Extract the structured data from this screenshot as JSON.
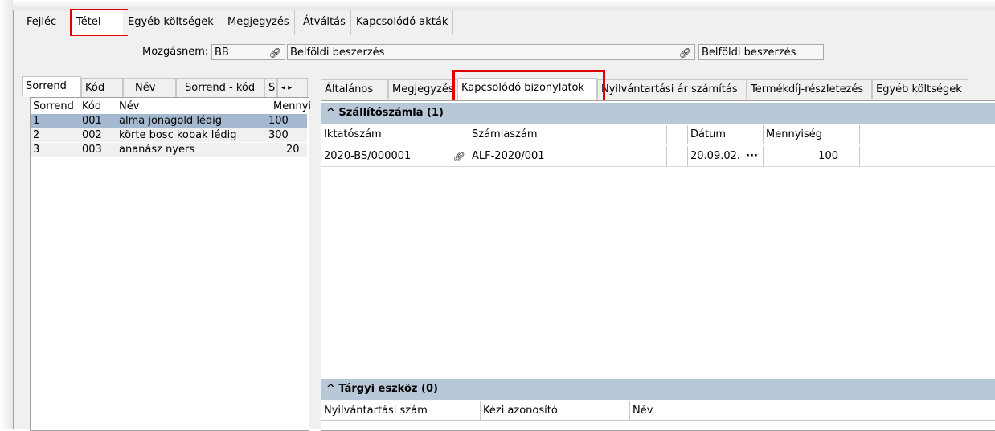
{
  "top_tabs": [
    "Fejléc",
    "Tétel",
    "Egyéb költségek",
    "Megjegyzés",
    "Átváltás",
    "Kapcsolódó akták"
  ],
  "mozgasnem": {
    "label": "Mozgásnem:",
    "code": "BB",
    "name": "Belföldi beszerzés",
    "name2": "Belföldi beszerzés"
  },
  "left_tabs": [
    "Sorrend",
    "Kód",
    "Név",
    "Sorrend - kód",
    "S"
  ],
  "left_grid": {
    "headers": [
      "Sorrend",
      "Kód",
      "Név",
      "Mennyi"
    ],
    "rows": [
      {
        "sorrend": "1",
        "kod": "001",
        "nev": "alma jonagold lédig",
        "menny": "100"
      },
      {
        "sorrend": "2",
        "kod": "002",
        "nev": "körte bosc kobak lédig",
        "menny": "300"
      },
      {
        "sorrend": "3",
        "kod": "003",
        "nev": "ananász nyers",
        "menny": "20"
      }
    ]
  },
  "right_tabs": [
    "Általános",
    "Megjegyzés",
    "Kapcsolódó bizonylatok",
    "Nyilvántartási ár számítás",
    "Termékdíj-részletezés",
    "Egyéb költségek"
  ],
  "szallito": {
    "title": "^ Szállítószámla (1)",
    "headers": [
      "Iktatószám",
      "Számlaszám",
      "",
      "Dátum",
      "Mennyiség"
    ],
    "row": {
      "iktato": "2020-BS/000001",
      "szamla": "ALF-2020/001",
      "datum": "20.09.02.",
      "dots": "···",
      "menny": "100"
    }
  },
  "targyi": {
    "title": "^ Tárgyi eszköz (0)",
    "headers": [
      "Nyilvántartási szám",
      "Kézi azonosító",
      "Név"
    ]
  },
  "icons": {
    "clip": "paperclip-icon",
    "left": "arrow-left-icon",
    "right": "arrow-right-icon"
  },
  "colors": {
    "highlight": "#e00000",
    "selected_row": "#a4b9d0",
    "group_header": "#b8c8d8"
  }
}
